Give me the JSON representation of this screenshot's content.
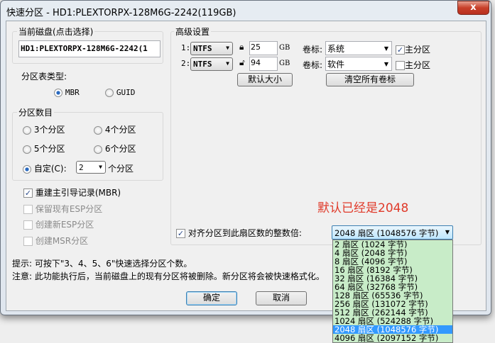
{
  "window": {
    "title": "快速分区 - HD1:PLEXTORPX-128M6G-2242(119GB)",
    "close": "x"
  },
  "disk": {
    "group_title": "当前磁盘(点击选择)",
    "value": "HD1:PLEXTORPX-128M6G-2242(1"
  },
  "table_type": {
    "label": "分区表类型:",
    "options": [
      "MBR",
      "GUID"
    ],
    "selected": "MBR"
  },
  "count": {
    "group_title": "分区数目",
    "options": [
      "3个分区",
      "4个分区",
      "5个分区",
      "6个分区"
    ],
    "custom_label": "自定(C):",
    "custom_value": "2",
    "suffix": "个分区"
  },
  "checks": [
    {
      "label": "重建主引导记录(MBR)",
      "checked": true,
      "enabled": true
    },
    {
      "label": "保留现有ESP分区",
      "checked": false,
      "enabled": false
    },
    {
      "label": "创建新ESP分区",
      "checked": false,
      "enabled": false
    },
    {
      "label": "创建MSR分区",
      "checked": false,
      "enabled": false
    }
  ],
  "advanced": {
    "title": "高级设置",
    "rows": [
      {
        "index": "1:",
        "fs": "NTFS",
        "size": "25",
        "unit": "GB",
        "label_caption": "卷标:",
        "label_value": "系统",
        "primary_label": "主分区",
        "primary": true,
        "locked": true
      },
      {
        "index": "2:",
        "fs": "NTFS",
        "size": "94",
        "unit": "GB",
        "label_caption": "卷标:",
        "label_value": "软件",
        "primary_label": "主分区",
        "primary": false,
        "locked": false
      }
    ],
    "default_size_btn": "默认大小",
    "clear_labels_btn": "清空所有卷标"
  },
  "annotation": {
    "text": "默认已经是2048",
    "color": "#e03a2a"
  },
  "align": {
    "label": "对齐分区到此扇区数的整数倍:",
    "checked": true,
    "selected": "2048 扇区 (1048576 字节)",
    "options": [
      "2 扇区 (1024 字节)",
      "4 扇区 (2048 字节)",
      "8 扇区 (4096 字节)",
      "16 扇区 (8192 字节)",
      "32 扇区 (16384 字节)",
      "64 扇区 (32768 字节)",
      "128 扇区 (65536 字节)",
      "256 扇区 (131072 字节)",
      "512 扇区 (262144 字节)",
      "1024 扇区 (524288 字节)",
      "2048 扇区 (1048576 字节)",
      "4096 扇区 (2097152 字节)"
    ],
    "highlighted_index": 10
  },
  "hints": [
    "提示: 可按下\"3、4、5、6\"快速选择分区个数。",
    "注意: 此功能执行后，当前磁盘上的现有分区将被删除。新分区将会被快速格式化。"
  ],
  "buttons": {
    "ok": "确定",
    "cancel": "取消"
  }
}
